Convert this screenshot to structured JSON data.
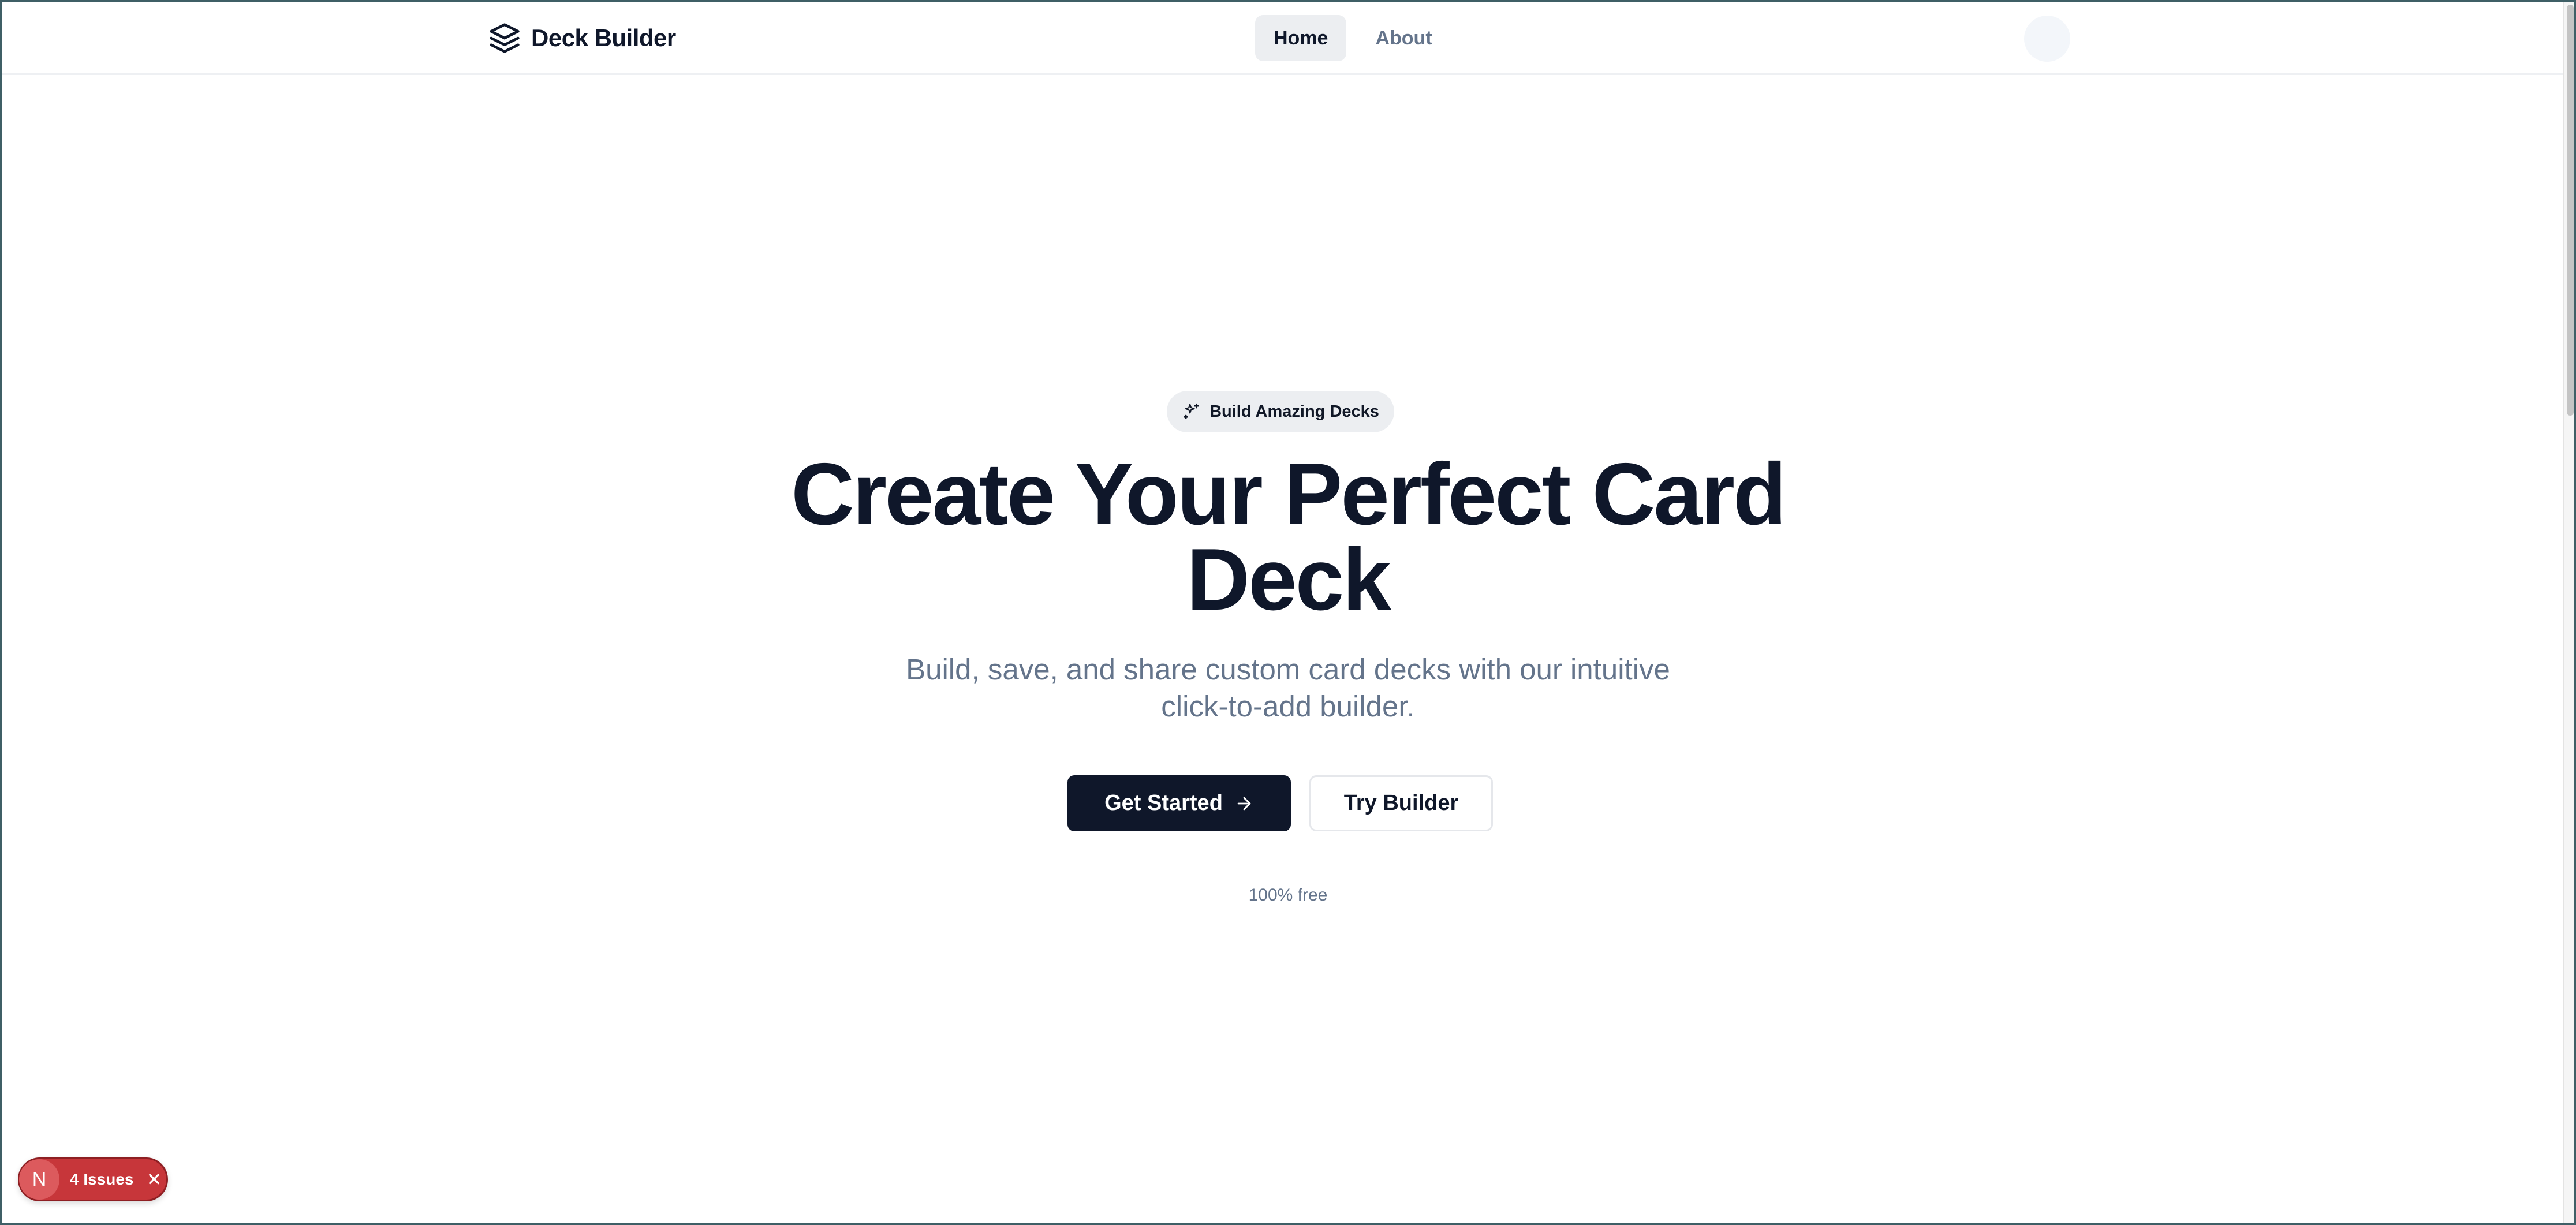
{
  "header": {
    "brand_name": "Deck Builder",
    "brand_icon": "layers-icon",
    "nav": [
      {
        "label": "Home",
        "active": true
      },
      {
        "label": "About",
        "active": false
      }
    ]
  },
  "hero": {
    "badge_icon": "sparkles-icon",
    "badge_label": "Build Amazing Decks",
    "title_line1": "Create Your Perfect Card",
    "title_line2": "Deck",
    "subtitle_line1": "Build, save, and share custom card decks with our intuitive",
    "subtitle_line2": "click-to-add builder.",
    "primary_button": "Get Started",
    "primary_button_icon": "arrow-right-icon",
    "secondary_button": "Try Builder",
    "note": "100% free"
  },
  "issues_badge": {
    "avatar_letter": "N",
    "label": "4 Issues",
    "close_glyph": "✕"
  },
  "colors": {
    "primary": "#0f172a",
    "muted_text": "#64748b",
    "issues_red": "#c7363a"
  }
}
